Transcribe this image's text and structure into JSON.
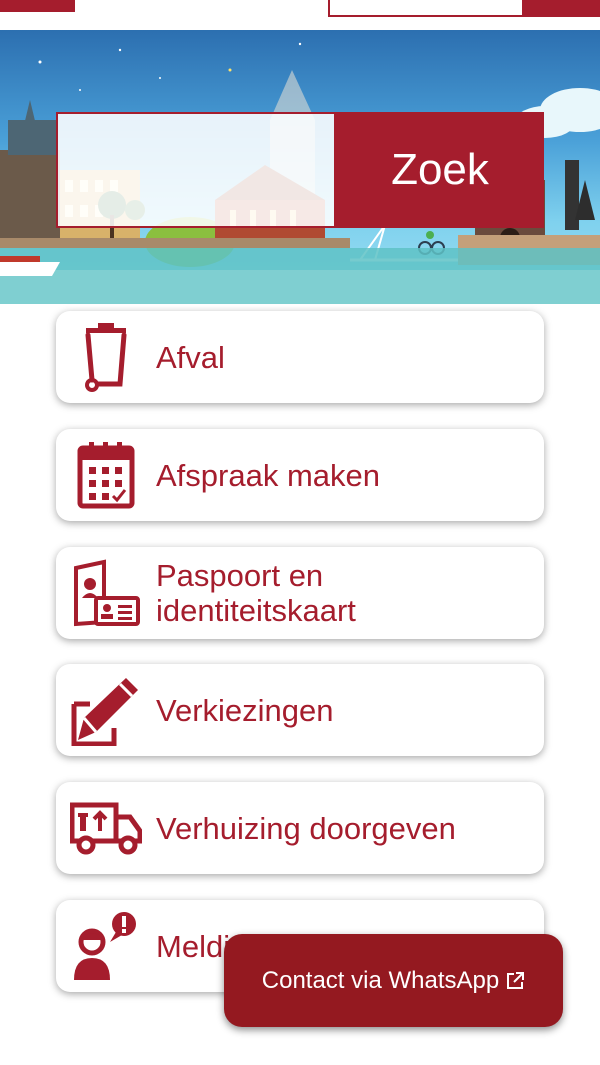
{
  "search": {
    "placeholder": "",
    "button_label": "Zoek"
  },
  "tiles": [
    {
      "label": "Afval",
      "icon": "waste-bin-icon"
    },
    {
      "label": "Afspraak maken",
      "icon": "calendar-icon"
    },
    {
      "label": "Paspoort en identiteitskaart",
      "label_line1": "Paspoort en",
      "label_line2": "identiteitskaart",
      "icon": "passport-id-card-icon"
    },
    {
      "label": "Verkiezingen",
      "icon": "pencil-ballot-icon"
    },
    {
      "label": "Verhuizing doorgeven",
      "icon": "moving-truck-icon"
    },
    {
      "label": "Meldingen",
      "label_visible": "Meldi",
      "icon": "person-alert-icon"
    }
  ],
  "whatsapp": {
    "label": "Contact via WhatsApp",
    "icon": "external-link-icon"
  },
  "colors": {
    "brand": "#a51d2d",
    "whatsapp_button": "#941920"
  }
}
